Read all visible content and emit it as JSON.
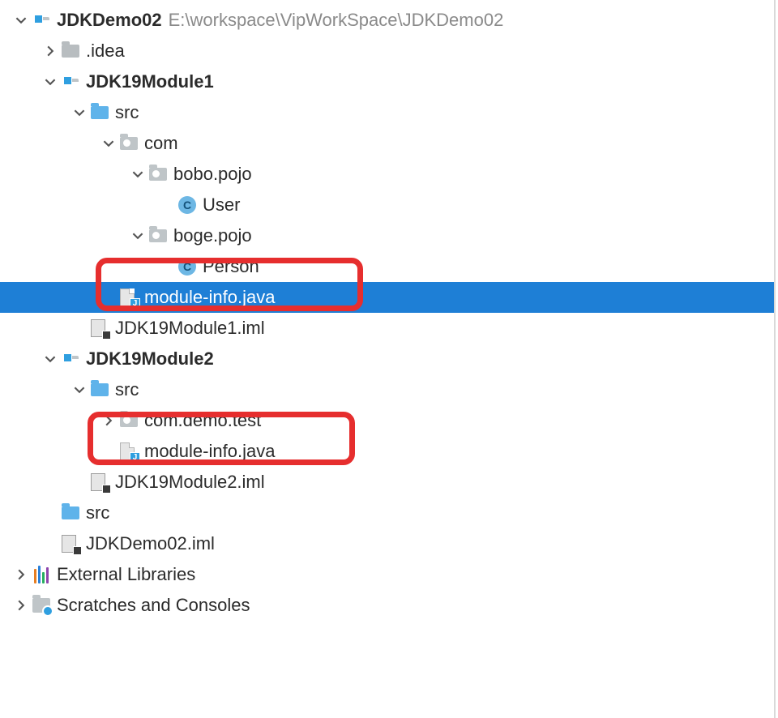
{
  "root": {
    "name": "JDKDemo02",
    "path": "E:\\workspace\\VipWorkSpace\\JDKDemo02",
    "idea": ".idea",
    "module1": {
      "name": "JDK19Module1",
      "src": "src",
      "com": "com",
      "pkg_bobo": "bobo.pojo",
      "class_user": "User",
      "pkg_boge": "boge.pojo",
      "class_person": "Person",
      "module_info": "module-info.java",
      "iml": "JDK19Module1.iml"
    },
    "module2": {
      "name": "JDK19Module2",
      "src": "src",
      "pkg_demo": "com.demo.test",
      "module_info": "module-info.java",
      "iml": "JDK19Module2.iml"
    },
    "src": "src",
    "iml": "JDKDemo02.iml"
  },
  "external_libs": "External Libraries",
  "scratches": "Scratches and Consoles"
}
